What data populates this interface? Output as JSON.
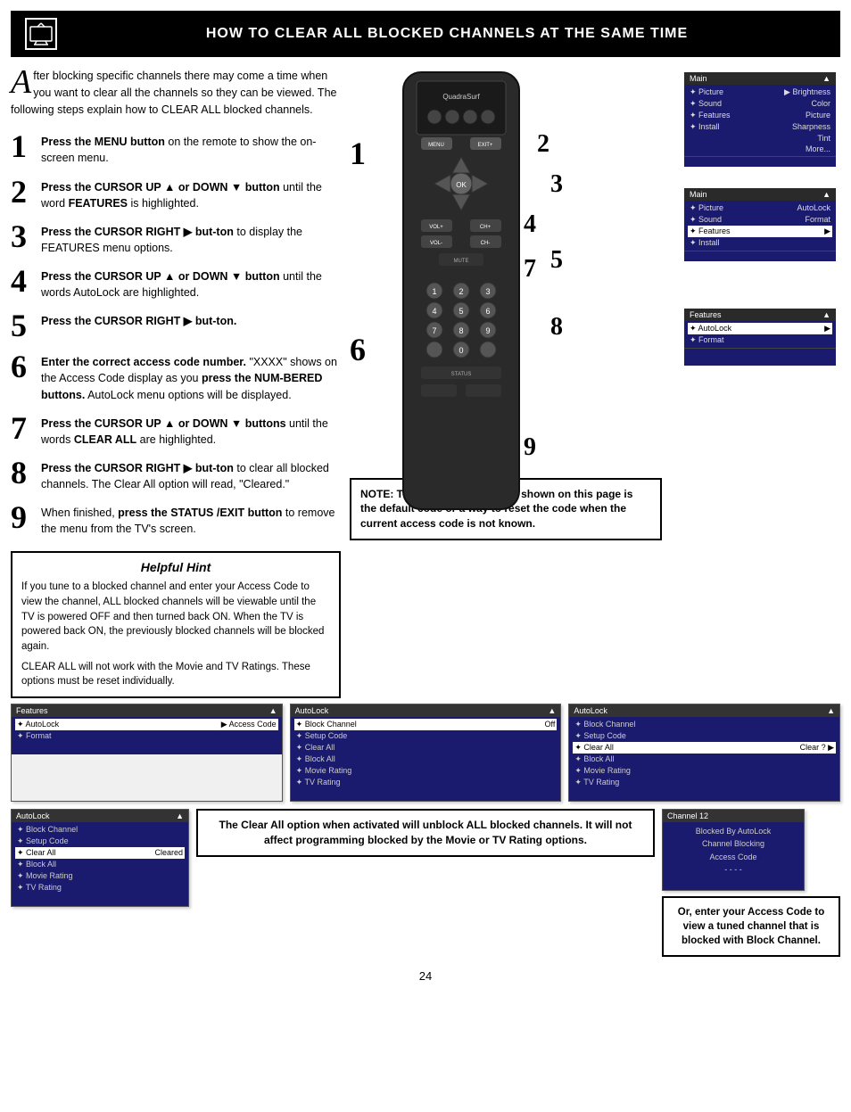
{
  "header": {
    "title": "How to Clear All Blocked Channels at the Same Time",
    "icon_label": "TV icon"
  },
  "intro": {
    "drop_cap": "A",
    "text": "fter blocking specific channels there may come a time when you want to clear all the channels so they can be viewed. The following steps explain how to CLEAR ALL blocked channels."
  },
  "steps": [
    {
      "number": "1",
      "text_parts": [
        {
          "type": "bold",
          "text": "Press the MENU button"
        },
        {
          "type": "normal",
          "text": " on the remote to show the on-screen menu."
        }
      ]
    },
    {
      "number": "2",
      "text_parts": [
        {
          "type": "bold",
          "text": "Press the CURSOR UP ▲ or DOWN ▼ button"
        },
        {
          "type": "normal",
          "text": " until the word "
        },
        {
          "type": "bold",
          "text": "FEATURES"
        },
        {
          "type": "normal",
          "text": " is highlighted."
        }
      ]
    },
    {
      "number": "3",
      "text_parts": [
        {
          "type": "bold",
          "text": "Press the CURSOR RIGHT ▶ but-ton"
        },
        {
          "type": "normal",
          "text": " to display the FEATURES menu options."
        }
      ]
    },
    {
      "number": "4",
      "text_parts": [
        {
          "type": "bold",
          "text": "Press the CURSOR UP ▲ or DOWN ▼ button"
        },
        {
          "type": "normal",
          "text": " until the words AutoLock are highlighted."
        }
      ]
    },
    {
      "number": "5",
      "text_parts": [
        {
          "type": "bold",
          "text": "Press the CURSOR RIGHT ▶ but-ton."
        }
      ]
    },
    {
      "number": "6",
      "text_parts": [
        {
          "type": "bold",
          "text": "Enter the correct access code number."
        },
        {
          "type": "normal",
          "text": " \"XXXX\" shows on the Access Code display as you "
        },
        {
          "type": "bold",
          "text": "press the NUM-BERED buttons."
        },
        {
          "type": "normal",
          "text": " AutoLock menu options will be displayed."
        }
      ]
    },
    {
      "number": "7",
      "text_parts": [
        {
          "type": "bold",
          "text": "Press the CURSOR UP ▲ or DOWN ▼ buttons"
        },
        {
          "type": "normal",
          "text": " until the words "
        },
        {
          "type": "bold",
          "text": "CLEAR ALL"
        },
        {
          "type": "normal",
          "text": " are highlighted."
        }
      ]
    },
    {
      "number": "8",
      "text_parts": [
        {
          "type": "bold",
          "text": "Press the CURSOR RIGHT ▶ but-ton"
        },
        {
          "type": "normal",
          "text": " to clear all blocked channels. The Clear All option will read, \"Cleared.\""
        }
      ]
    },
    {
      "number": "9",
      "text_parts": [
        {
          "type": "normal",
          "text": "When finished, "
        },
        {
          "type": "bold",
          "text": "press the STATUS /EXIT button"
        },
        {
          "type": "normal",
          "text": " to remove the menu from the TV's screen."
        }
      ]
    }
  ],
  "hint": {
    "title": "Helpful Hint",
    "paragraphs": [
      "If you tune to a blocked channel and enter your Access Code to view the channel, ALL blocked channels will be viewable until the TV is powered OFF and then turned back ON. When the TV is powered back ON, the previously blocked channels will be blocked again.",
      "CLEAR ALL will not work with the Movie and TV Ratings. These options must be reset individually."
    ]
  },
  "note": {
    "text": "NOTE: The 0,7,1,1 access code shown on this page is the default code or a way to reset the code when the current access code is not known."
  },
  "menu_panels_right": [
    {
      "id": "panel1",
      "header": {
        "left": "Main",
        "right": "▲"
      },
      "rows": [
        {
          "label": "✦ Picture",
          "value": "▶ Brightness",
          "selected": false
        },
        {
          "label": "✦ Sound",
          "value": "Color",
          "selected": false
        },
        {
          "label": "✦ Features",
          "value": "Picture",
          "selected": false
        },
        {
          "label": "✦ Install",
          "value": "Sharpness",
          "selected": false
        },
        {
          "label": "",
          "value": "Tint",
          "selected": false
        },
        {
          "label": "",
          "value": "More...",
          "selected": false
        }
      ],
      "step_num": "1"
    },
    {
      "id": "panel2",
      "header": {
        "left": "Main",
        "right": "▲"
      },
      "rows": [
        {
          "label": "✦ Picture",
          "value": "AutoLock",
          "selected": false
        },
        {
          "label": "✦ Sound",
          "value": "Format",
          "selected": false
        },
        {
          "label": "✦ Features",
          "value": "",
          "selected": true
        },
        {
          "label": "✦ Install",
          "value": "",
          "selected": false
        }
      ],
      "step_num": "2"
    },
    {
      "id": "panel3",
      "header": {
        "left": "Features",
        "right": "▲"
      },
      "rows": [
        {
          "label": "✦ AutoLock",
          "value": "▶",
          "selected": true
        },
        {
          "label": "✦ Format",
          "value": "",
          "selected": false
        }
      ],
      "step_num": "3"
    }
  ],
  "bottom_panels_row1": [
    {
      "id": "bp1",
      "header": {
        "left": "Features",
        "right": "▲"
      },
      "rows": [
        {
          "label": "✦ AutoLock",
          "value": "▶ Access Code",
          "selected": true
        },
        {
          "label": "✦ Format",
          "value": "",
          "selected": false
        }
      ]
    },
    {
      "id": "bp2",
      "header": {
        "left": "AutoLock",
        "right": "▲"
      },
      "rows": [
        {
          "label": "✦ Block Channel",
          "value": "Off",
          "selected": true
        },
        {
          "label": "✦ Setup Code",
          "value": "",
          "selected": false
        },
        {
          "label": "✦ Clear All",
          "value": "",
          "selected": false
        },
        {
          "label": "✦ Block All",
          "value": "",
          "selected": false
        },
        {
          "label": "✦ Movie Rating",
          "value": "",
          "selected": false
        },
        {
          "label": "✦ TV Rating",
          "value": "",
          "selected": false
        }
      ]
    },
    {
      "id": "bp3",
      "header": {
        "left": "AutoLock",
        "right": "▲"
      },
      "rows": [
        {
          "label": "✦ Block Channel",
          "value": "",
          "selected": false
        },
        {
          "label": "✦ Setup Code",
          "value": "",
          "selected": false
        },
        {
          "label": "✦ Clear All",
          "value": "Clear ? ▶",
          "selected": true
        },
        {
          "label": "✦ Block All",
          "value": "",
          "selected": false
        },
        {
          "label": "✦ Movie Rating",
          "value": "",
          "selected": false
        },
        {
          "label": "✦ TV Rating",
          "value": "",
          "selected": false
        }
      ]
    }
  ],
  "bottom_panels_row2_left": {
    "header": {
      "left": "AutoLock",
      "right": "▲"
    },
    "rows": [
      {
        "label": "✦ Block Channel",
        "value": "",
        "selected": false
      },
      {
        "label": "✦ Setup Code",
        "value": "",
        "selected": false
      },
      {
        "label": "✦ Clear All",
        "value": "Cleared",
        "selected": true
      },
      {
        "label": "✦ Block All",
        "value": "",
        "selected": false
      },
      {
        "label": "✦ Movie Rating",
        "value": "",
        "selected": false
      },
      {
        "label": "✦ TV Rating",
        "value": "",
        "selected": false
      }
    ]
  },
  "bottom_channel_panel": {
    "header": "Channel 12",
    "lines": [
      "Blocked By AutoLock",
      "Channel Blocking",
      "Access Code",
      "- - - -"
    ]
  },
  "captions": {
    "left": "The Clear All option when activated will unblock ALL blocked channels. It will not affect programming blocked by the Movie or TV Rating options.",
    "right": "Or, enter your Access Code to view a tuned channel that is blocked with Block Channel."
  },
  "page_number": "24",
  "menu_step_numbers": {
    "overlay_1": "1",
    "overlay_2": "2",
    "overlay_3": "3",
    "overlay_4": "4",
    "overlay_5": "5",
    "overlay_6": "6",
    "overlay_7": "7",
    "overlay_8": "8",
    "overlay_9": "9"
  }
}
